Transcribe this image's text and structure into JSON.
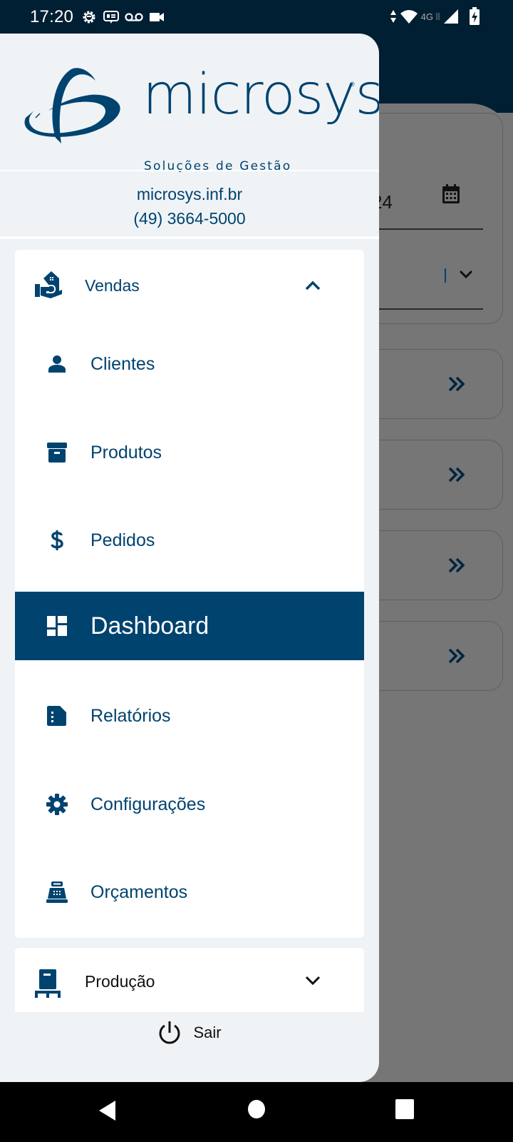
{
  "status_bar": {
    "time": "17:20",
    "left_icons": [
      "settings-debug-icon",
      "message-icon",
      "voicemail-icon",
      "video-camera-icon"
    ],
    "network_label": "4G",
    "right_icons": [
      "data-arrows-icon",
      "wifi-icon",
      "signal-icon",
      "battery-charging-icon"
    ]
  },
  "background_screen": {
    "date_value_partial": "24",
    "nav_cards_count": 4,
    "colors": {
      "header": "#001F33",
      "scrim": "#767676"
    }
  },
  "drawer": {
    "logo": {
      "wordmark": "microsys",
      "registered": "®",
      "tagline": "Soluções de Gestão"
    },
    "contact": {
      "website": "microsys.inf.br",
      "phone": "(49) 3664-5000"
    },
    "groups": [
      {
        "label": "Vendas",
        "icon": "sales-house-hand-icon",
        "expanded": true,
        "items": [
          {
            "label": "Clientes",
            "icon": "person-icon",
            "active": false
          },
          {
            "label": "Produtos",
            "icon": "archive-box-icon",
            "active": false
          },
          {
            "label": "Pedidos",
            "icon": "dollar-icon",
            "active": false
          },
          {
            "label": "Dashboard",
            "icon": "dashboard-icon",
            "active": true
          },
          {
            "label": "Relatórios",
            "icon": "report-file-icon",
            "active": false
          },
          {
            "label": "Configurações",
            "icon": "gear-icon",
            "active": false
          },
          {
            "label": "Orçamentos",
            "icon": "cash-register-icon",
            "active": false
          }
        ]
      },
      {
        "label": "Produção",
        "icon": "pallet-icon",
        "expanded": false
      }
    ],
    "logout_label": "Sair",
    "colors": {
      "primary": "#00436F",
      "drawer_bg": "#EFF3F6",
      "card_bg": "#FFFFFF"
    }
  },
  "nav_bar": {
    "buttons": [
      "back",
      "home",
      "recents"
    ]
  }
}
